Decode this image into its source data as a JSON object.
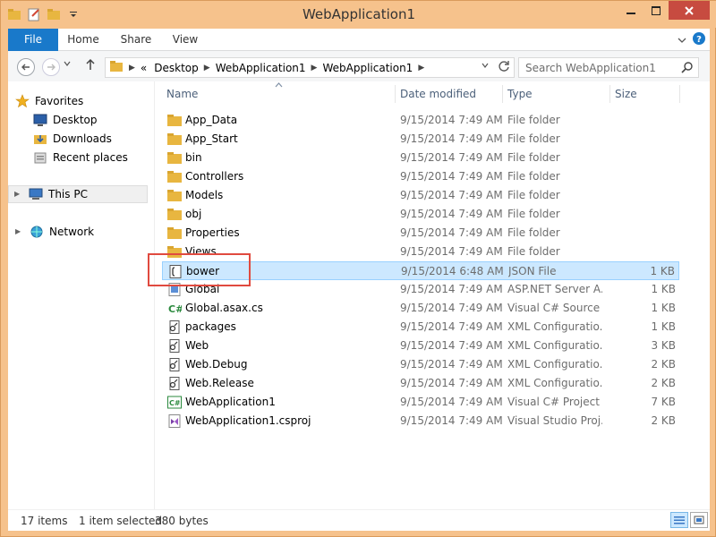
{
  "window": {
    "title": "WebApplication1"
  },
  "ribbon": {
    "tabs": {
      "file": "File",
      "home": "Home",
      "share": "Share",
      "view": "View"
    }
  },
  "address": {
    "overflow": "«",
    "path": [
      "Desktop",
      "WebApplication1",
      "WebApplication1"
    ]
  },
  "search": {
    "placeholder": "Search WebApplication1"
  },
  "nav": {
    "favorites": "Favorites",
    "desktop": "Desktop",
    "downloads": "Downloads",
    "recent": "Recent places",
    "thispc": "This PC",
    "network": "Network"
  },
  "columns": {
    "name": "Name",
    "date": "Date modified",
    "type": "Type",
    "size": "Size"
  },
  "files": [
    {
      "name": "App_Data",
      "date": "9/15/2014 7:49 AM",
      "type": "File folder",
      "size": "",
      "icon": "folder-icon"
    },
    {
      "name": "App_Start",
      "date": "9/15/2014 7:49 AM",
      "type": "File folder",
      "size": "",
      "icon": "folder-icon"
    },
    {
      "name": "bin",
      "date": "9/15/2014 7:49 AM",
      "type": "File folder",
      "size": "",
      "icon": "folder-icon"
    },
    {
      "name": "Controllers",
      "date": "9/15/2014 7:49 AM",
      "type": "File folder",
      "size": "",
      "icon": "folder-icon"
    },
    {
      "name": "Models",
      "date": "9/15/2014 7:49 AM",
      "type": "File folder",
      "size": "",
      "icon": "folder-icon"
    },
    {
      "name": "obj",
      "date": "9/15/2014 7:49 AM",
      "type": "File folder",
      "size": "",
      "icon": "folder-icon"
    },
    {
      "name": "Properties",
      "date": "9/15/2014 7:49 AM",
      "type": "File folder",
      "size": "",
      "icon": "folder-icon"
    },
    {
      "name": "Views",
      "date": "9/15/2014 7:49 AM",
      "type": "File folder",
      "size": "",
      "icon": "folder-icon"
    },
    {
      "name": "bower",
      "date": "9/15/2014 6:48 AM",
      "type": "JSON File",
      "size": "1 KB",
      "icon": "json-file-icon"
    },
    {
      "name": "Global",
      "date": "9/15/2014 7:49 AM",
      "type": "ASP.NET Server A...",
      "size": "1 KB",
      "icon": "aspnet-file-icon"
    },
    {
      "name": "Global.asax.cs",
      "date": "9/15/2014 7:49 AM",
      "type": "Visual C# Source f...",
      "size": "1 KB",
      "icon": "csharp-source-icon"
    },
    {
      "name": "packages",
      "date": "9/15/2014 7:49 AM",
      "type": "XML Configuratio...",
      "size": "1 KB",
      "icon": "xml-config-icon"
    },
    {
      "name": "Web",
      "date": "9/15/2014 7:49 AM",
      "type": "XML Configuratio...",
      "size": "3 KB",
      "icon": "xml-config-icon"
    },
    {
      "name": "Web.Debug",
      "date": "9/15/2014 7:49 AM",
      "type": "XML Configuratio...",
      "size": "2 KB",
      "icon": "xml-config-icon"
    },
    {
      "name": "Web.Release",
      "date": "9/15/2014 7:49 AM",
      "type": "XML Configuratio...",
      "size": "2 KB",
      "icon": "xml-config-icon"
    },
    {
      "name": "WebApplication1",
      "date": "9/15/2014 7:49 AM",
      "type": "Visual C# Project f...",
      "size": "7 KB",
      "icon": "csharp-project-icon"
    },
    {
      "name": "WebApplication1.csproj",
      "date": "9/15/2014 7:49 AM",
      "type": "Visual Studio Proj...",
      "size": "2 KB",
      "icon": "vs-project-icon"
    }
  ],
  "selected_index": 8,
  "status": {
    "count": "17 items",
    "selection": "1 item selected",
    "size": "380 bytes"
  },
  "colors": {
    "file_tab": "#1979ca",
    "selection_bg": "#cce8ff",
    "selection_border": "#99d1ff",
    "highlight_box": "#e04a3f",
    "folder": "#e8b640"
  }
}
